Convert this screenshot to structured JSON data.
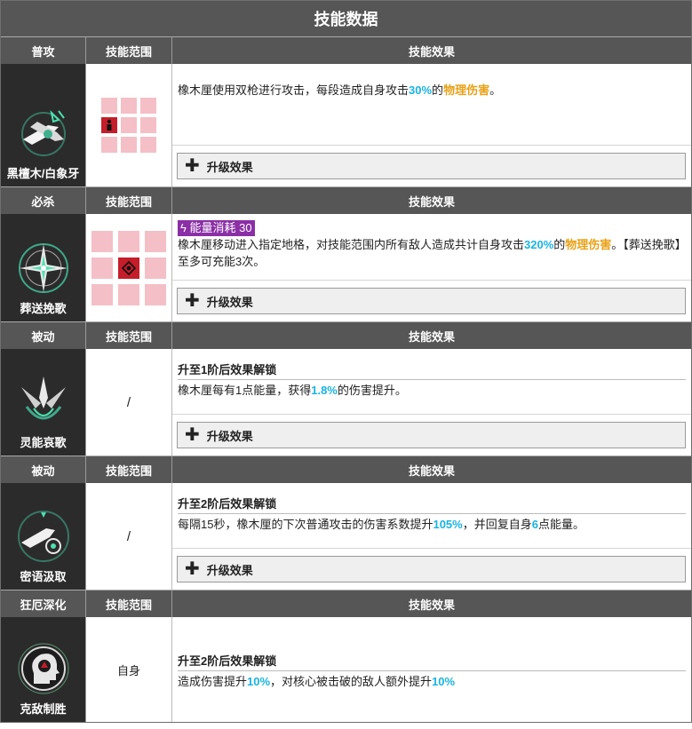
{
  "title": "技能数据",
  "colors": {
    "header_bg": "#565656",
    "cyan": "#1ab3e0",
    "orange": "#e8a117",
    "range_pink": "#f4bfc6",
    "range_red": "#c51d2a",
    "energy_purple": "#8a2fa6"
  },
  "common_headers": {
    "range": "技能范围",
    "effect": "技能效果"
  },
  "upgrade_label": "升级效果",
  "skills": [
    {
      "type": "普攻",
      "name": "黑檀木/白象牙",
      "icon": "dual-gun-icon",
      "effect": {
        "t1": "橡木厘使用双枪进行攻击，每段造成自身攻击",
        "v1": "30%",
        "t2": "的",
        "v2": "物理伤害",
        "t3": "。"
      }
    },
    {
      "type": "必杀",
      "name": "葬送挽歌",
      "icon": "compass-star-icon",
      "energy": "能量消耗 30",
      "effect": {
        "t1": "橡木厘移动进入指定地格，对技能范围内所有敌人造成共计自身攻击",
        "v1": "320%",
        "t2": "的",
        "v2": "物理伤害",
        "t3": "。【葬送挽歌】至多可充能3次。"
      }
    },
    {
      "type": "被动",
      "name": "灵能哀歌",
      "icon": "arrow-crown-icon",
      "range_text": "/",
      "unlock": "升至1阶后效果解锁",
      "effect": {
        "t1": "橡木厘每有1点能量，获得",
        "v1": "1.8%",
        "t2": "的伤害提升。"
      }
    },
    {
      "type": "被动",
      "name": "密语汲取",
      "icon": "gun-target-icon",
      "range_text": "/",
      "unlock": "升至2阶后效果解锁",
      "effect": {
        "t1": "每隔15秒，橡木厘的下次普通攻击的伤害系数提升",
        "v1": "105%",
        "t2": "，并回复自身",
        "v2": "6",
        "t3": "点能量。"
      }
    },
    {
      "type": "狂厄深化",
      "name": "克敌制胜",
      "icon": "head-gear-icon",
      "range_text": "自身",
      "unlock": "升至2阶后效果解锁",
      "effect": {
        "t1": "造成伤害提升",
        "v1": "10%",
        "t2": "，对核心被击破的敌人额外提升",
        "v2": "10%"
      }
    }
  ]
}
